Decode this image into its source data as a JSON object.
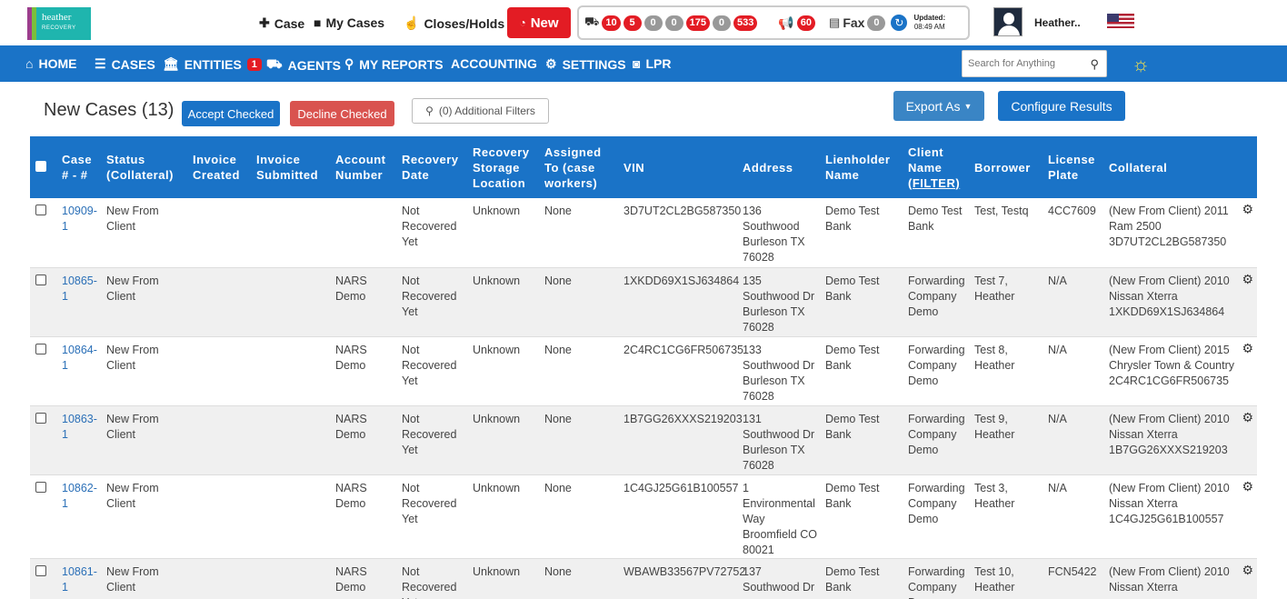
{
  "logo": {
    "line1": "heather",
    "line2": "RECOVERY"
  },
  "topnav": {
    "case": "Case",
    "my_cases": "My Cases",
    "closes_holds": "Closes/Holds",
    "new": "New"
  },
  "status_counts": [
    {
      "value": "10",
      "color": "red"
    },
    {
      "value": "5",
      "color": "red"
    },
    {
      "value": "0",
      "color": "gray"
    },
    {
      "value": "0",
      "color": "gray"
    },
    {
      "value": "175",
      "color": "red"
    },
    {
      "value": "0",
      "color": "gray"
    },
    {
      "value": "533",
      "color": "red"
    }
  ],
  "announcements_count": "60",
  "fax": {
    "label": "Fax",
    "count": "0"
  },
  "updated": {
    "label": "Updated:",
    "time": "08:49 AM"
  },
  "user": {
    "name": "Heather.."
  },
  "navbar": {
    "home": "HOME",
    "cases": "CASES",
    "entities": "ENTITIES",
    "entities_badge": "1",
    "agents": "AGENTS",
    "my_reports": "MY REPORTS",
    "accounting": "ACCOUNTING",
    "settings": "SETTINGS",
    "lpr": "LPR"
  },
  "search": {
    "placeholder": "Search for Anything"
  },
  "toolbar": {
    "title": "New Cases (13)",
    "accept": "Accept Checked",
    "decline": "Decline Checked",
    "filters": "(0) Additional Filters",
    "export": "Export As",
    "configure": "Configure Results"
  },
  "table": {
    "headers": {
      "case": "Case # - #",
      "status": "Status (Collateral)",
      "invoice_created": "Invoice Created",
      "invoice_submitted": "Invoice Submitted",
      "account_number": "Account Number",
      "recovery_date": "Recovery Date",
      "storage": "Recovery Storage Location",
      "assigned": "Assigned To (case workers)",
      "vin": "VIN",
      "address": "Address",
      "lienholder": "Lienholder Name",
      "client_name": "Client Name",
      "client_filter": "(FILTER)",
      "borrower": "Borrower",
      "plate": "License Plate",
      "collateral": "Collateral"
    },
    "rows": [
      {
        "case": "10909-1",
        "status": "New From Client",
        "invoice_created": "",
        "invoice_submitted": "",
        "account": "",
        "recovery": "Not Recovered Yet",
        "storage": "Unknown",
        "assigned": "None",
        "vin": "3D7UT2CL2BG587350",
        "address": "136 Southwood Burleson TX 76028",
        "lienholder": "Demo Test Bank",
        "client": "Demo Test Bank",
        "borrower": "Test, Testq",
        "plate": "4CC7609",
        "collateral": "(New From Client) 2011 Ram 2500 3D7UT2CL2BG587350"
      },
      {
        "case": "10865-1",
        "status": "New From Client",
        "invoice_created": "",
        "invoice_submitted": "",
        "account": "NARS Demo",
        "recovery": "Not Recovered Yet",
        "storage": "Unknown",
        "assigned": "None",
        "vin": "1XKDD69X1SJ634864",
        "address": "135 Southwood Dr Burleson TX 76028",
        "lienholder": "Demo Test Bank",
        "client": "Forwarding Company Demo",
        "borrower": "Test 7, Heather",
        "plate": "N/A",
        "collateral": "(New From Client) 2010 Nissan Xterra 1XKDD69X1SJ634864"
      },
      {
        "case": "10864-1",
        "status": "New From Client",
        "invoice_created": "",
        "invoice_submitted": "",
        "account": "NARS Demo",
        "recovery": "Not Recovered Yet",
        "storage": "Unknown",
        "assigned": "None",
        "vin": "2C4RC1CG6FR506735",
        "address": "133 Southwood Dr Burleson TX 76028",
        "lienholder": "Demo Test Bank",
        "client": "Forwarding Company Demo",
        "borrower": "Test 8, Heather",
        "plate": "N/A",
        "collateral": "(New From Client) 2015 Chrysler Town & Country 2C4RC1CG6FR506735"
      },
      {
        "case": "10863-1",
        "status": "New From Client",
        "invoice_created": "",
        "invoice_submitted": "",
        "account": "NARS Demo",
        "recovery": "Not Recovered Yet",
        "storage": "Unknown",
        "assigned": "None",
        "vin": "1B7GG26XXXS219203",
        "address": "131 Southwood Dr Burleson TX 76028",
        "lienholder": "Demo Test Bank",
        "client": "Forwarding Company Demo",
        "borrower": "Test 9, Heather",
        "plate": "N/A",
        "collateral": "(New From Client) 2010 Nissan Xterra 1B7GG26XXXS219203"
      },
      {
        "case": "10862-1",
        "status": "New From Client",
        "invoice_created": "",
        "invoice_submitted": "",
        "account": "NARS Demo",
        "recovery": "Not Recovered Yet",
        "storage": "Unknown",
        "assigned": "None",
        "vin": "1C4GJ25G61B100557",
        "address": "1 Environmental Way Broomfield CO 80021",
        "lienholder": "Demo Test Bank",
        "client": "Forwarding Company Demo",
        "borrower": "Test 3, Heather",
        "plate": "N/A",
        "collateral": "(New From Client) 2010 Nissan Xterra 1C4GJ25G61B100557"
      },
      {
        "case": "10861-1",
        "status": "New From Client",
        "invoice_created": "",
        "invoice_submitted": "",
        "account": "NARS Demo",
        "recovery": "Not Recovered Yet",
        "storage": "Unknown",
        "assigned": "None",
        "vin": "WBAWB33567PV72752",
        "address": "137 Southwood Dr",
        "lienholder": "Demo Test Bank",
        "client": "Forwarding Company Demo",
        "borrower": "Test 10, Heather",
        "plate": "FCN5422",
        "collateral": "(New From Client) 2010 Nissan Xterra"
      }
    ]
  },
  "colors": {
    "primary": "#1a73c7",
    "danger": "#e31c24",
    "decline": "#d9534f"
  }
}
